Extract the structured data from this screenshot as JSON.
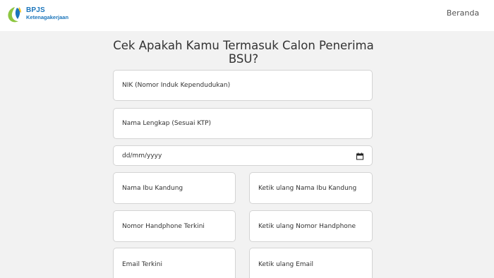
{
  "header": {
    "logo": {
      "name_primary": "BPJS",
      "name_secondary": "Ketenagakerjaan",
      "colors": {
        "green": "#8dc63f",
        "blue": "#1b75bb"
      }
    },
    "nav": {
      "home_label": "Beranda"
    }
  },
  "form": {
    "title": "Cek Apakah Kamu Termasuk Calon Penerima BSU?",
    "fields": {
      "nik": "NIK (Nomor Induk Kependudukan)",
      "nama_lengkap": "Nama Lengkap (Sesuai KTP)",
      "tanggal_lahir": "dd/mm/yyyy",
      "nama_ibu": "Nama Ibu Kandung",
      "nama_ibu_ulang": "Ketik ulang Nama Ibu Kandung",
      "nomor_hp": "Nomor Handphone Terkini",
      "nomor_hp_ulang": "Ketik ulang Nomor Handphone",
      "email": "Email Terkini",
      "email_ulang": "Ketik ulang Email"
    }
  },
  "icons": {
    "date_picker": "calendar-icon"
  }
}
